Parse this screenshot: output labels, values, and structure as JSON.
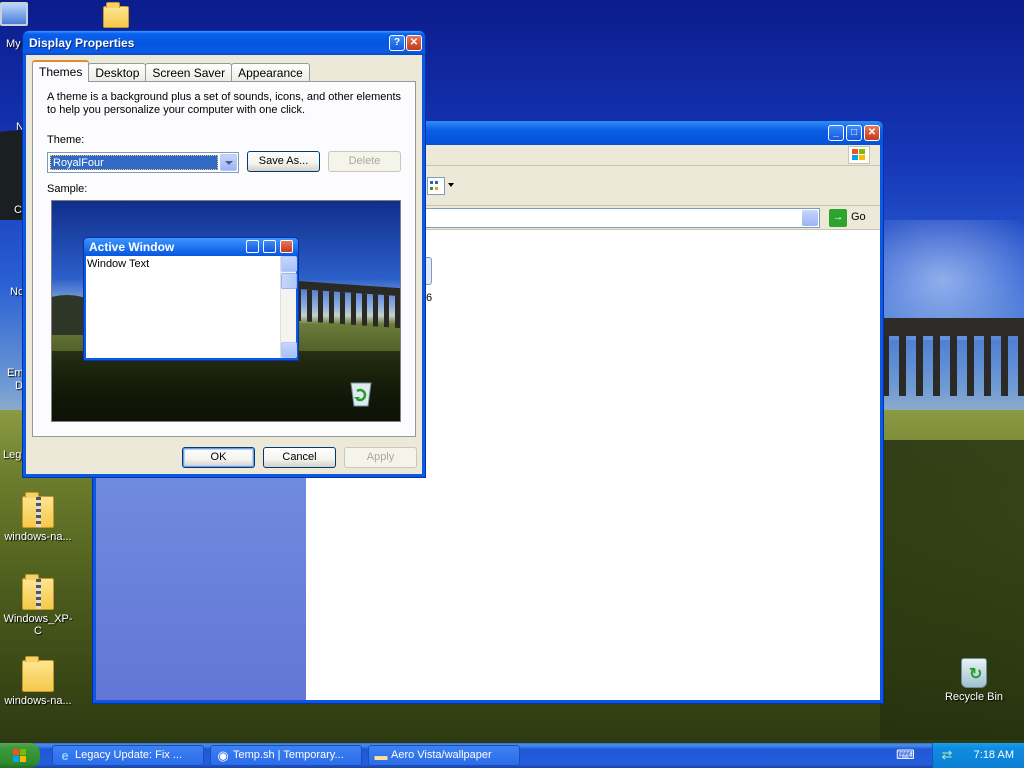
{
  "desktop": {
    "icons": [
      {
        "label": "My",
        "icon": "my-computer-icon"
      },
      {
        "label": "windows-na...",
        "icon": "zip-folder-icon"
      },
      {
        "label": "Windows_XP-C",
        "icon": "zip-folder-icon"
      },
      {
        "label": "windows-na...",
        "icon": "folder-icon"
      },
      {
        "label": "Recycle Bin",
        "icon": "recycle-bin-icon"
      }
    ],
    "partial_labels": [
      "N",
      "C",
      "No",
      "Em",
      "D",
      "Lega"
    ]
  },
  "explorer": {
    "address_go_label": "Go",
    "partial_item_text": "6"
  },
  "dialog": {
    "title": "Display Properties",
    "tabs": [
      "Themes",
      "Desktop",
      "Screen Saver",
      "Appearance"
    ],
    "active_tab": "Themes",
    "description": "A theme is a background plus a set of sounds, icons, and other elements to help you personalize your computer with one click.",
    "theme_label": "Theme:",
    "theme_value": "RoyalFour",
    "save_as_label": "Save As...",
    "delete_label": "Delete",
    "sample_label": "Sample:",
    "sample_window": {
      "title": "Active Window",
      "text": "Window Text"
    },
    "ok_label": "OK",
    "cancel_label": "Cancel",
    "apply_label": "Apply"
  },
  "taskbar": {
    "tasks": [
      {
        "label": "Legacy Update: Fix ...",
        "icon": "internet-explorer-icon"
      },
      {
        "label": "Temp.sh | Temporary...",
        "icon": "browser-icon"
      },
      {
        "label": "Aero Vista/wallpaper",
        "icon": "folder-icon"
      }
    ],
    "clock": "7:18 AM"
  },
  "colors": {
    "titlebar_blue": "#0556e0",
    "dialog_face": "#ece9d8",
    "selection": "#316ac5",
    "start_green": "#3d9a3d",
    "tray_blue": "#0f8ce0"
  }
}
